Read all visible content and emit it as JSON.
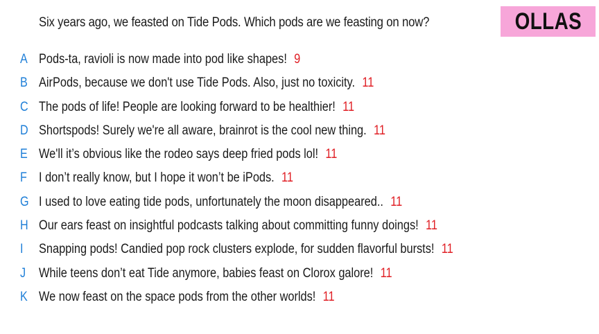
{
  "prompt": "Six years ago, we feasted on Tide Pods. Which pods are we feasting on now?",
  "badge": "OLLAS",
  "colors": {
    "letter": "#1f7fd8",
    "score": "#e01f25",
    "badge_bg": "#f7a6d9"
  },
  "answers": [
    {
      "letter": "A",
      "text": "Pods-ta, ravioli is now made into pod like shapes!",
      "score": "9"
    },
    {
      "letter": "B",
      "text": "AirPods, because we don't use Tide Pods. Also, just no toxicity.",
      "score": "11"
    },
    {
      "letter": "C",
      "text": "The pods of life! People are looking forward to be healthier!",
      "score": "11"
    },
    {
      "letter": "D",
      "text": "Shortspods! Surely we're all aware, brainrot is the cool new thing.",
      "score": "11"
    },
    {
      "letter": "E",
      "text": "We'll  it’s obvious like the rodeo says deep fried pods lol!",
      "score": "11"
    },
    {
      "letter": "F",
      "text": "I don’t really know, but I hope it won’t be iPods.",
      "score": "11"
    },
    {
      "letter": "G",
      "text": "I used to love eating tide pods, unfortunately the moon disappeared..",
      "score": "11"
    },
    {
      "letter": "H",
      "text": "Our ears feast on insightful podcasts talking about committing funny doings!",
      "score": "11"
    },
    {
      "letter": "I",
      "text": "Snapping pods! Candied pop rock clusters explode, for sudden flavorful bursts!",
      "score": "11"
    },
    {
      "letter": "J",
      "text": "While teens don’t eat Tide anymore, babies feast on Clorox galore!",
      "score": "11"
    },
    {
      "letter": "K",
      "text": "We now feast on the space pods from the other worlds!",
      "score": "11"
    }
  ]
}
